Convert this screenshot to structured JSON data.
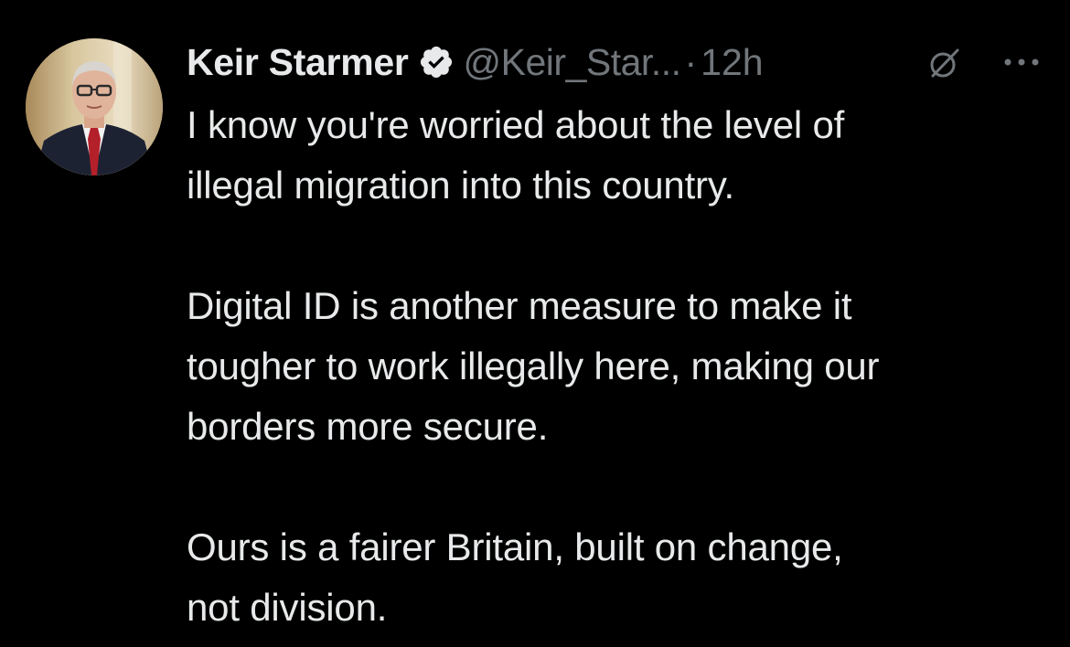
{
  "author": {
    "display_name": "Keir Starmer",
    "handle": "@Keir_Star...",
    "separator": "·",
    "time": "12h",
    "verified_icon": "verified-badge-icon",
    "accent": "#1d9bf0"
  },
  "actions": {
    "grok_icon": "grok-icon",
    "more_icon": "more-options-icon"
  },
  "tweet": {
    "paragraphs": [
      {
        "lines": [
          "I know you're worried about the level of",
          "illegal migration into this country."
        ]
      },
      {
        "lines": [
          "Digital ID is another measure to make it",
          "tougher to work illegally here, making our",
          "borders more secure."
        ]
      },
      {
        "lines": [
          "Ours is a fairer Britain, built on change,",
          "not division."
        ]
      }
    ]
  },
  "colors": {
    "background": "#000000",
    "primary_text": "#e7e9ea",
    "secondary_text": "#71767b"
  }
}
